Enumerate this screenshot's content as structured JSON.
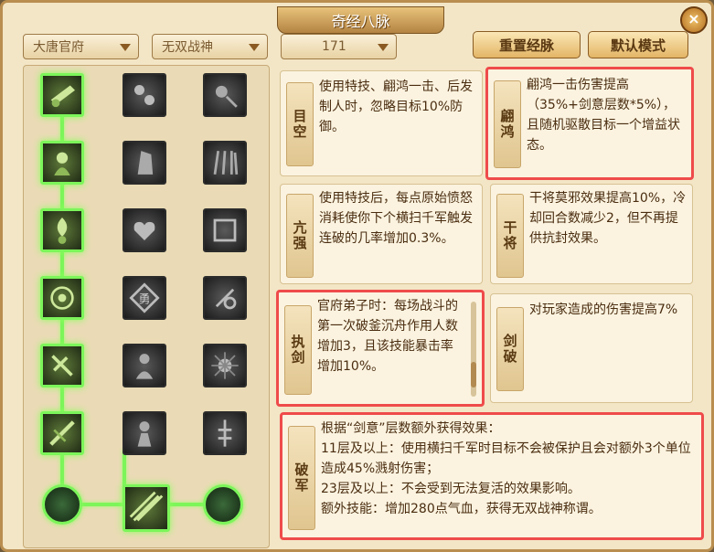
{
  "title": "奇经八脉",
  "close": "×",
  "filters": {
    "school": "大唐官府",
    "style": "无双战神",
    "level": "171"
  },
  "buttons": {
    "reset": "重置经脉",
    "default": "默认模式"
  },
  "cards": [
    {
      "name": "目空",
      "text": "使用特技、翩鸿一击、后发制人时，忽略目标10%防御。"
    },
    {
      "name": "翩鸿",
      "text": "翩鸿一击伤害提高（35%+剑意层数*5%），且随机驱散目标一个增益状态。"
    },
    {
      "name": "亢强",
      "text": "使用特技后，每点原始愤怒消耗使你下个横扫千军触发连破的几率增加0.3%。"
    },
    {
      "name": "干将",
      "text": "干将莫邪效果提高10%，冷却回合数减少2，但不再提供抗封效果。"
    },
    {
      "name": "执剑",
      "text": "官府弟子时：每场战斗的第一次破釜沉舟作用人数增加3，且该技能暴击率增加10%。"
    },
    {
      "name": "剑破",
      "text": "对玩家造成的伤害提高7%"
    },
    {
      "name": "破军",
      "text": "根据“剑意”层数额外获得效果：\n11层及以上：使用横扫千军时目标不会被保护且会对额外3个单位造成45%溅射伤害；\n23层及以上：不会受到无法复活的效果影响。\n额外技能：增加280点气血，获得无双战神称谓。"
    }
  ]
}
